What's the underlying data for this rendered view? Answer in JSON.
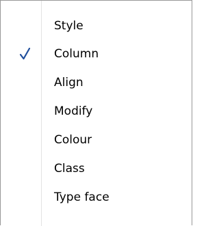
{
  "context_menu": {
    "items": [
      {
        "label": "Style",
        "checked": false
      },
      {
        "label": "Column",
        "checked": true
      },
      {
        "label": "Align",
        "checked": false
      },
      {
        "label": "Modify",
        "checked": false
      },
      {
        "label": "Colour",
        "checked": false
      },
      {
        "label": "Class",
        "checked": false
      },
      {
        "label": "Type face",
        "checked": false
      }
    ],
    "check_icon": "checkmark-icon",
    "check_color": "#1f4e9c",
    "gutter_color": "#e2e3e3",
    "border_color": "#979797"
  }
}
